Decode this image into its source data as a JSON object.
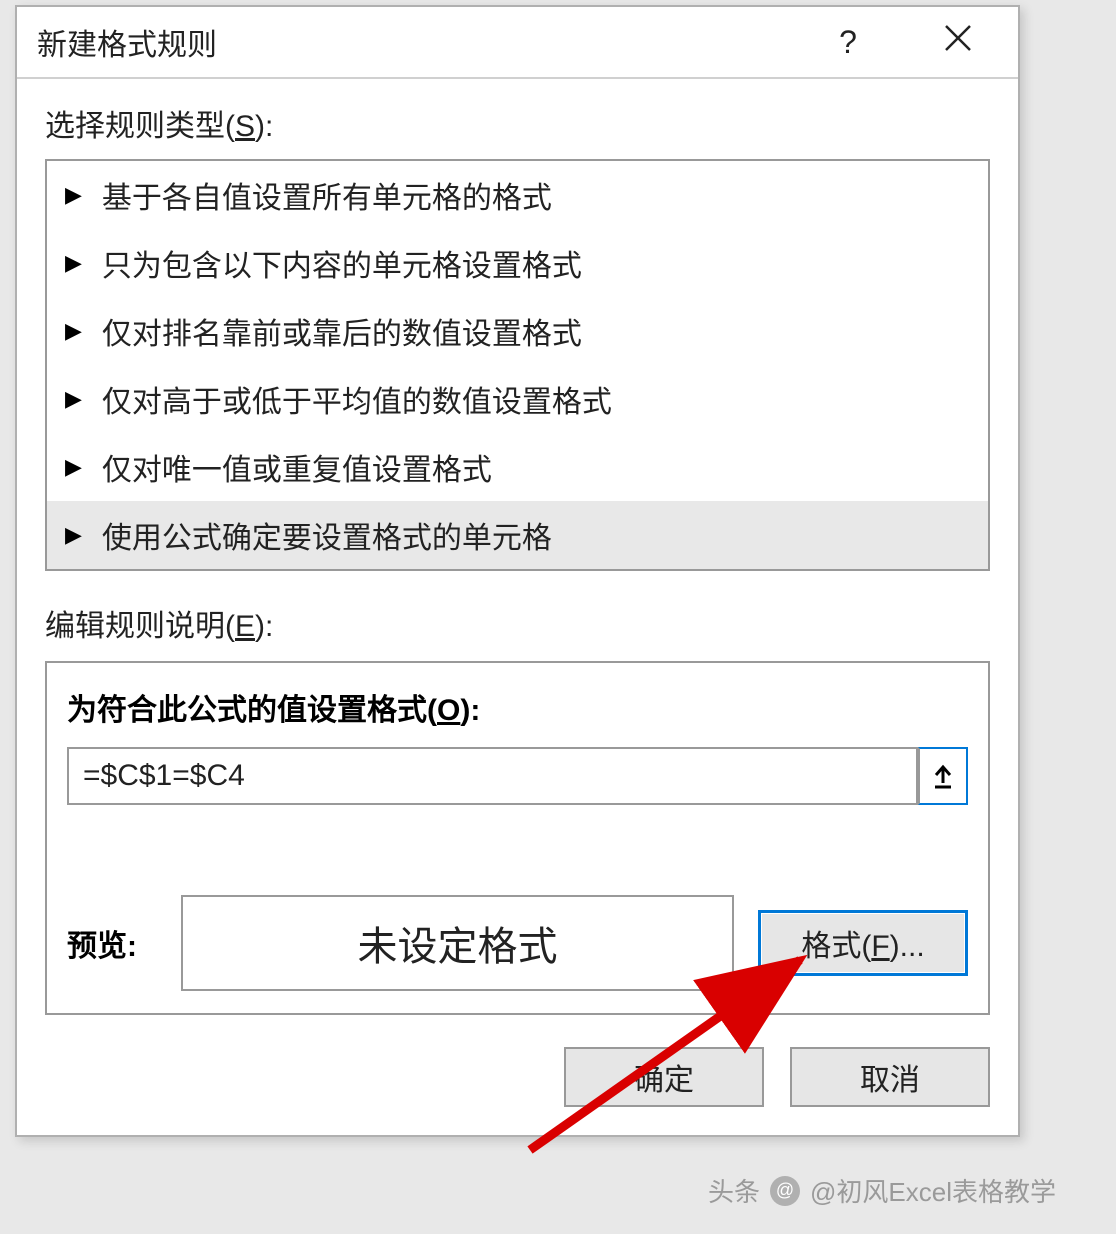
{
  "dialog": {
    "title": "新建格式规则",
    "help_symbol": "?",
    "section_rule_type": "选择规则类型(",
    "section_rule_type_hotkey": "S",
    "section_rule_type_suffix": "):",
    "rule_types": [
      "基于各自值设置所有单元格的格式",
      "只为包含以下内容的单元格设置格式",
      "仅对排名靠前或靠后的数值设置格式",
      "仅对高于或低于平均值的数值设置格式",
      "仅对唯一值或重复值设置格式",
      "使用公式确定要设置格式的单元格"
    ],
    "selected_rule_index": 5,
    "section_edit": "编辑规则说明(",
    "section_edit_hotkey": "E",
    "section_edit_suffix": "):",
    "formula_title": "为符合此公式的值设置格式(",
    "formula_title_hotkey": "O",
    "formula_title_suffix": "):",
    "formula_value": "=$C$1=$C4",
    "preview_label": "预览:",
    "preview_text": "未设定格式",
    "format_button": "格式(",
    "format_button_hotkey": "F",
    "format_button_suffix": ")...",
    "ok_button": "确定",
    "cancel_button": "取消"
  },
  "watermark": {
    "prefix": "头条",
    "text": "@初风Excel表格教学"
  }
}
